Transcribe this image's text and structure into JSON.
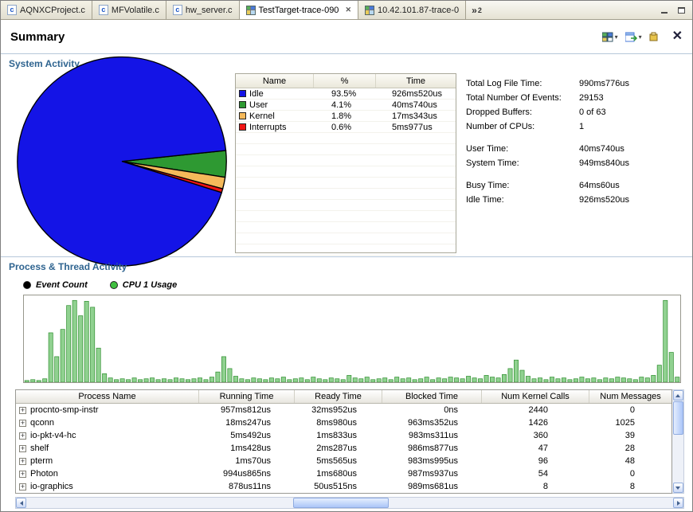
{
  "icons": {
    "chevron": "»",
    "close": "✕",
    "dropdown": "▾",
    "expand": "+",
    "c_file": "c"
  },
  "window": {
    "tabs": [
      {
        "label": "AQNXCProject.c",
        "icon": "c-file",
        "active": false
      },
      {
        "label": "MFVolatile.c",
        "icon": "c-file",
        "active": false
      },
      {
        "label": "hw_server.c",
        "icon": "c-file",
        "active": false
      },
      {
        "label": "TestTarget-trace-090",
        "icon": "trace-file",
        "active": true
      },
      {
        "label": "10.42.101.87-trace-0",
        "icon": "trace-file",
        "active": false
      }
    ],
    "more_tabs_count": "2"
  },
  "header": {
    "title": "Summary"
  },
  "system_activity": {
    "heading": "System Activity",
    "table": {
      "columns": [
        "Name",
        "%",
        "Time"
      ],
      "rows": [
        {
          "name": "Idle",
          "color": "#1414e6",
          "pct": "93.5%",
          "time": "926ms520us"
        },
        {
          "name": "User",
          "color": "#2e9932",
          "pct": "4.1%",
          "time": "40ms740us"
        },
        {
          "name": "Kernel",
          "color": "#f5b95a",
          "pct": "1.8%",
          "time": "17ms343us"
        },
        {
          "name": "Interrupts",
          "color": "#f01414",
          "pct": "0.6%",
          "time": "5ms977us"
        }
      ]
    },
    "stats": [
      {
        "group": 1,
        "label": "Total Log File Time:",
        "value": "990ms776us"
      },
      {
        "group": 1,
        "label": "Total Number Of Events:",
        "value": "29153"
      },
      {
        "group": 1,
        "label": "Dropped Buffers:",
        "value": "0 of 63"
      },
      {
        "group": 1,
        "label": "Number of CPUs:",
        "value": "1"
      },
      {
        "group": 2,
        "label": "User Time:",
        "value": "40ms740us"
      },
      {
        "group": 2,
        "label": "System Time:",
        "value": "949ms840us"
      },
      {
        "group": 3,
        "label": "Busy Time:",
        "value": "64ms60us"
      },
      {
        "group": 3,
        "label": "Idle Time:",
        "value": "926ms520us"
      }
    ]
  },
  "process_activity": {
    "heading": "Process & Thread Activity",
    "legend": [
      {
        "label": "Event Count",
        "color": "#000000"
      },
      {
        "label": "CPU 1 Usage",
        "color": "#3fbf3f"
      }
    ],
    "table": {
      "columns": [
        "Process Name",
        "Running Time",
        "Ready Time",
        "Blocked Time",
        "Num Kernel Calls",
        "Num Messages"
      ],
      "rows": [
        {
          "name": "procnto-smp-instr",
          "running": "957ms812us",
          "ready": "32ms952us",
          "blocked": "0ns",
          "kernel_calls": "2440",
          "messages": "0"
        },
        {
          "name": "qconn",
          "running": "18ms247us",
          "ready": "8ms980us",
          "blocked": "963ms352us",
          "kernel_calls": "1426",
          "messages": "1025"
        },
        {
          "name": "io-pkt-v4-hc",
          "running": "5ms492us",
          "ready": "1ms833us",
          "blocked": "983ms311us",
          "kernel_calls": "360",
          "messages": "39"
        },
        {
          "name": "shelf",
          "running": "1ms428us",
          "ready": "2ms287us",
          "blocked": "986ms877us",
          "kernel_calls": "47",
          "messages": "28"
        },
        {
          "name": "pterm",
          "running": "1ms70us",
          "ready": "5ms565us",
          "blocked": "983ms995us",
          "kernel_calls": "96",
          "messages": "48"
        },
        {
          "name": "Photon",
          "running": "994us865ns",
          "ready": "1ms680us",
          "blocked": "987ms937us",
          "kernel_calls": "54",
          "messages": "0"
        },
        {
          "name": "io-graphics",
          "running": "878us11ns",
          "ready": "50us515ns",
          "blocked": "989ms681us",
          "kernel_calls": "8",
          "messages": "8"
        }
      ]
    }
  },
  "chart_data": [
    {
      "type": "pie",
      "title": "System Activity CPU usage",
      "labels": [
        "Idle",
        "User",
        "Kernel",
        "Interrupts"
      ],
      "values": [
        93.5,
        4.1,
        1.8,
        0.6
      ],
      "colors": [
        "#1414e6",
        "#2e9932",
        "#f5b95a",
        "#f01414"
      ],
      "legend_position": "table-right"
    },
    {
      "type": "area",
      "title": "Process & Thread Activity over time",
      "ylim": [
        0,
        100
      ],
      "grid": false,
      "legend": [
        "Event Count",
        "CPU 1 Usage"
      ],
      "series": [
        {
          "name": "CPU 1 Usage",
          "color": "#3fbf3f",
          "values": [
            2,
            3,
            2,
            4,
            58,
            30,
            62,
            90,
            96,
            78,
            95,
            88,
            40,
            10,
            5,
            3,
            4,
            3,
            5,
            3,
            4,
            5,
            3,
            4,
            3,
            5,
            4,
            3,
            4,
            5,
            3,
            6,
            12,
            30,
            16,
            7,
            4,
            3,
            5,
            4,
            3,
            5,
            4,
            6,
            3,
            4,
            5,
            3,
            6,
            4,
            3,
            5,
            4,
            3,
            8,
            5,
            4,
            6,
            3,
            4,
            5,
            3,
            6,
            4,
            5,
            3,
            4,
            6,
            3,
            5,
            4,
            6,
            5,
            4,
            7,
            5,
            4,
            8,
            6,
            5,
            9,
            16,
            26,
            14,
            7,
            4,
            5,
            3,
            6,
            4,
            5,
            3,
            4,
            6,
            4,
            5,
            3,
            5,
            4,
            6,
            5,
            4,
            3,
            6,
            5,
            8,
            20,
            96,
            35,
            6
          ]
        }
      ]
    }
  ]
}
